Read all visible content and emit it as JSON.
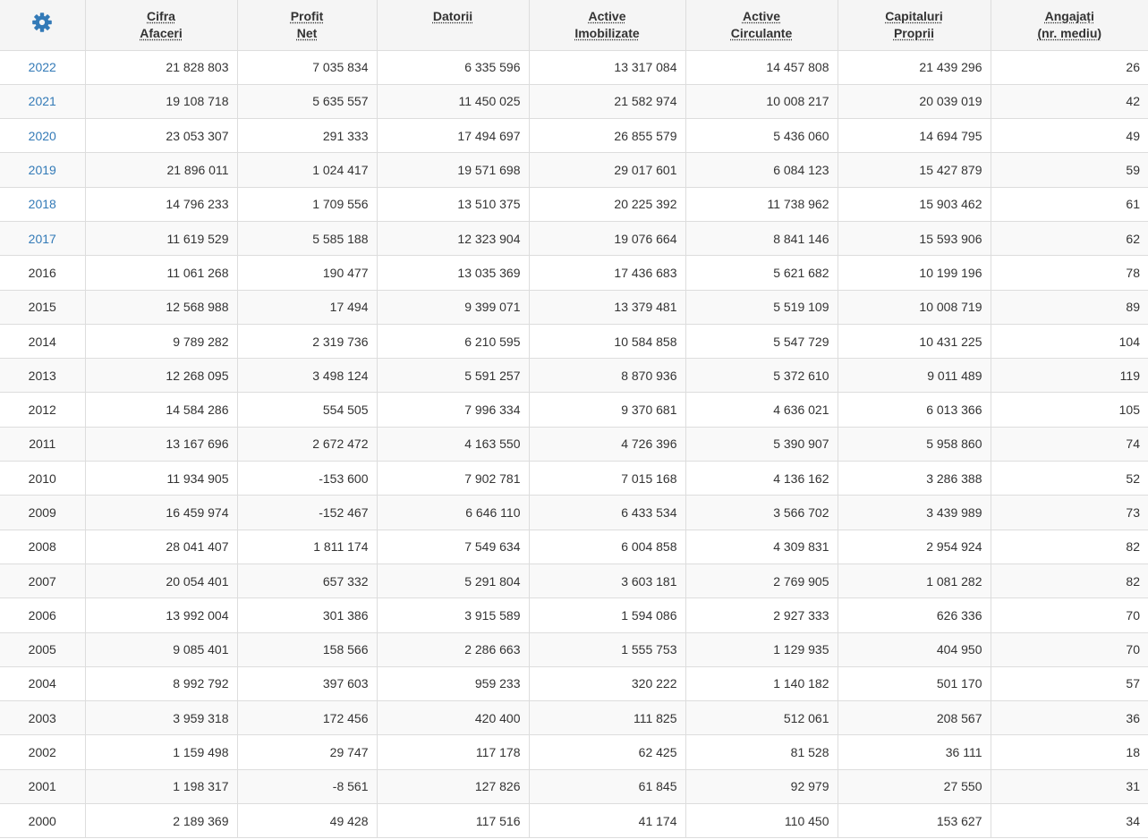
{
  "columns": [
    {
      "lines": [
        "Cifra",
        "Afaceri"
      ]
    },
    {
      "lines": [
        "Profit",
        "Net"
      ]
    },
    {
      "lines": [
        "Datorii"
      ]
    },
    {
      "lines": [
        "Active",
        "Imobilizate"
      ]
    },
    {
      "lines": [
        "Active",
        "Circulante"
      ]
    },
    {
      "lines": [
        "Capitaluri",
        "Proprii"
      ]
    },
    {
      "lines": [
        "Angajați",
        "(nr. mediu)"
      ]
    }
  ],
  "settings_icon": "gear-icon",
  "colors": {
    "link": "#337ab7",
    "icon": "#337ab7",
    "header_bg": "#f5f5f5",
    "stripe": "#f9f9f9",
    "border": "#dddddd"
  },
  "rows": [
    {
      "year": "2022",
      "link": true,
      "values": [
        "21 828 803",
        "7 035 834",
        "6 335 596",
        "13 317 084",
        "14 457 808",
        "21 439 296",
        "26"
      ]
    },
    {
      "year": "2021",
      "link": true,
      "values": [
        "19 108 718",
        "5 635 557",
        "11 450 025",
        "21 582 974",
        "10 008 217",
        "20 039 019",
        "42"
      ]
    },
    {
      "year": "2020",
      "link": true,
      "values": [
        "23 053 307",
        "291 333",
        "17 494 697",
        "26 855 579",
        "5 436 060",
        "14 694 795",
        "49"
      ]
    },
    {
      "year": "2019",
      "link": true,
      "values": [
        "21 896 011",
        "1 024 417",
        "19 571 698",
        "29 017 601",
        "6 084 123",
        "15 427 879",
        "59"
      ]
    },
    {
      "year": "2018",
      "link": true,
      "values": [
        "14 796 233",
        "1 709 556",
        "13 510 375",
        "20 225 392",
        "11 738 962",
        "15 903 462",
        "61"
      ]
    },
    {
      "year": "2017",
      "link": true,
      "values": [
        "11 619 529",
        "5 585 188",
        "12 323 904",
        "19 076 664",
        "8 841 146",
        "15 593 906",
        "62"
      ]
    },
    {
      "year": "2016",
      "link": false,
      "values": [
        "11 061 268",
        "190 477",
        "13 035 369",
        "17 436 683",
        "5 621 682",
        "10 199 196",
        "78"
      ]
    },
    {
      "year": "2015",
      "link": false,
      "values": [
        "12 568 988",
        "17 494",
        "9 399 071",
        "13 379 481",
        "5 519 109",
        "10 008 719",
        "89"
      ]
    },
    {
      "year": "2014",
      "link": false,
      "values": [
        "9 789 282",
        "2 319 736",
        "6 210 595",
        "10 584 858",
        "5 547 729",
        "10 431 225",
        "104"
      ]
    },
    {
      "year": "2013",
      "link": false,
      "values": [
        "12 268 095",
        "3 498 124",
        "5 591 257",
        "8 870 936",
        "5 372 610",
        "9 011 489",
        "119"
      ]
    },
    {
      "year": "2012",
      "link": false,
      "values": [
        "14 584 286",
        "554 505",
        "7 996 334",
        "9 370 681",
        "4 636 021",
        "6 013 366",
        "105"
      ]
    },
    {
      "year": "2011",
      "link": false,
      "values": [
        "13 167 696",
        "2 672 472",
        "4 163 550",
        "4 726 396",
        "5 390 907",
        "5 958 860",
        "74"
      ]
    },
    {
      "year": "2010",
      "link": false,
      "values": [
        "11 934 905",
        "-153 600",
        "7 902 781",
        "7 015 168",
        "4 136 162",
        "3 286 388",
        "52"
      ]
    },
    {
      "year": "2009",
      "link": false,
      "values": [
        "16 459 974",
        "-152 467",
        "6 646 110",
        "6 433 534",
        "3 566 702",
        "3 439 989",
        "73"
      ]
    },
    {
      "year": "2008",
      "link": false,
      "values": [
        "28 041 407",
        "1 811 174",
        "7 549 634",
        "6 004 858",
        "4 309 831",
        "2 954 924",
        "82"
      ]
    },
    {
      "year": "2007",
      "link": false,
      "values": [
        "20 054 401",
        "657 332",
        "5 291 804",
        "3 603 181",
        "2 769 905",
        "1 081 282",
        "82"
      ]
    },
    {
      "year": "2006",
      "link": false,
      "values": [
        "13 992 004",
        "301 386",
        "3 915 589",
        "1 594 086",
        "2 927 333",
        "626 336",
        "70"
      ]
    },
    {
      "year": "2005",
      "link": false,
      "values": [
        "9 085 401",
        "158 566",
        "2 286 663",
        "1 555 753",
        "1 129 935",
        "404 950",
        "70"
      ]
    },
    {
      "year": "2004",
      "link": false,
      "values": [
        "8 992 792",
        "397 603",
        "959 233",
        "320 222",
        "1 140 182",
        "501 170",
        "57"
      ]
    },
    {
      "year": "2003",
      "link": false,
      "values": [
        "3 959 318",
        "172 456",
        "420 400",
        "111 825",
        "512 061",
        "208 567",
        "36"
      ]
    },
    {
      "year": "2002",
      "link": false,
      "values": [
        "1 159 498",
        "29 747",
        "117 178",
        "62 425",
        "81 528",
        "36 111",
        "18"
      ]
    },
    {
      "year": "2001",
      "link": false,
      "values": [
        "1 198 317",
        "-8 561",
        "127 826",
        "61 845",
        "92 979",
        "27 550",
        "31"
      ]
    },
    {
      "year": "2000",
      "link": false,
      "values": [
        "2 189 369",
        "49 428",
        "117 516",
        "41 174",
        "110 450",
        "153 627",
        "34"
      ]
    }
  ]
}
